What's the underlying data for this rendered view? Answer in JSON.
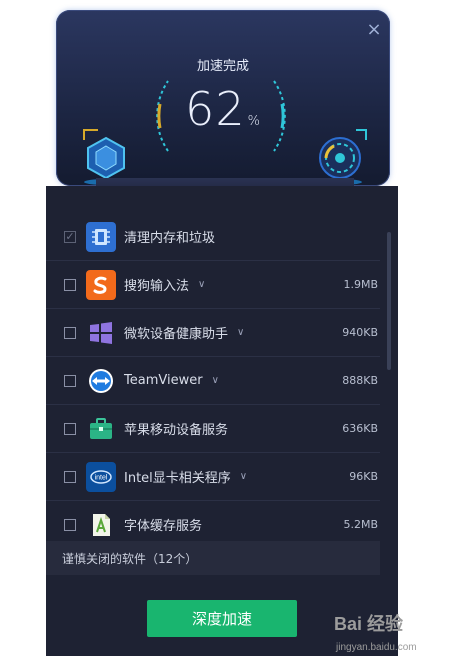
{
  "header": {
    "status": "加速完成",
    "percent": "62",
    "percent_sign": "%",
    "close_symbol": "×",
    "accent_color": "#2fc6d9"
  },
  "items": [
    {
      "name": "清理内存和垃圾",
      "size": "",
      "checked": true,
      "has_chevron": false,
      "icon": "memory-chip-icon"
    },
    {
      "name": "搜狗输入法",
      "size": "1.9MB",
      "checked": false,
      "has_chevron": true,
      "icon": "sogou-icon"
    },
    {
      "name": "微软设备健康助手",
      "size": "940KB",
      "checked": false,
      "has_chevron": true,
      "icon": "windows-icon"
    },
    {
      "name": "TeamViewer",
      "size": "888KB",
      "checked": false,
      "has_chevron": true,
      "icon": "teamviewer-icon"
    },
    {
      "name": "苹果移动设备服务",
      "size": "636KB",
      "checked": false,
      "has_chevron": false,
      "icon": "toolbox-icon"
    },
    {
      "name": "Intel显卡相关程序",
      "size": "96KB",
      "checked": false,
      "has_chevron": true,
      "icon": "intel-icon"
    },
    {
      "name": "字体缓存服务",
      "size": "5.2MB",
      "checked": false,
      "has_chevron": false,
      "icon": "font-file-icon"
    }
  ],
  "chevron_symbol": "∨",
  "check_symbol": "✓",
  "footer_note": "谨慎关闭的软件（12个）",
  "action_button": "深度加速",
  "action_color": "#19b56f",
  "watermark": {
    "main": "Bai 经验",
    "sub": "jingyan.baidu.com"
  }
}
